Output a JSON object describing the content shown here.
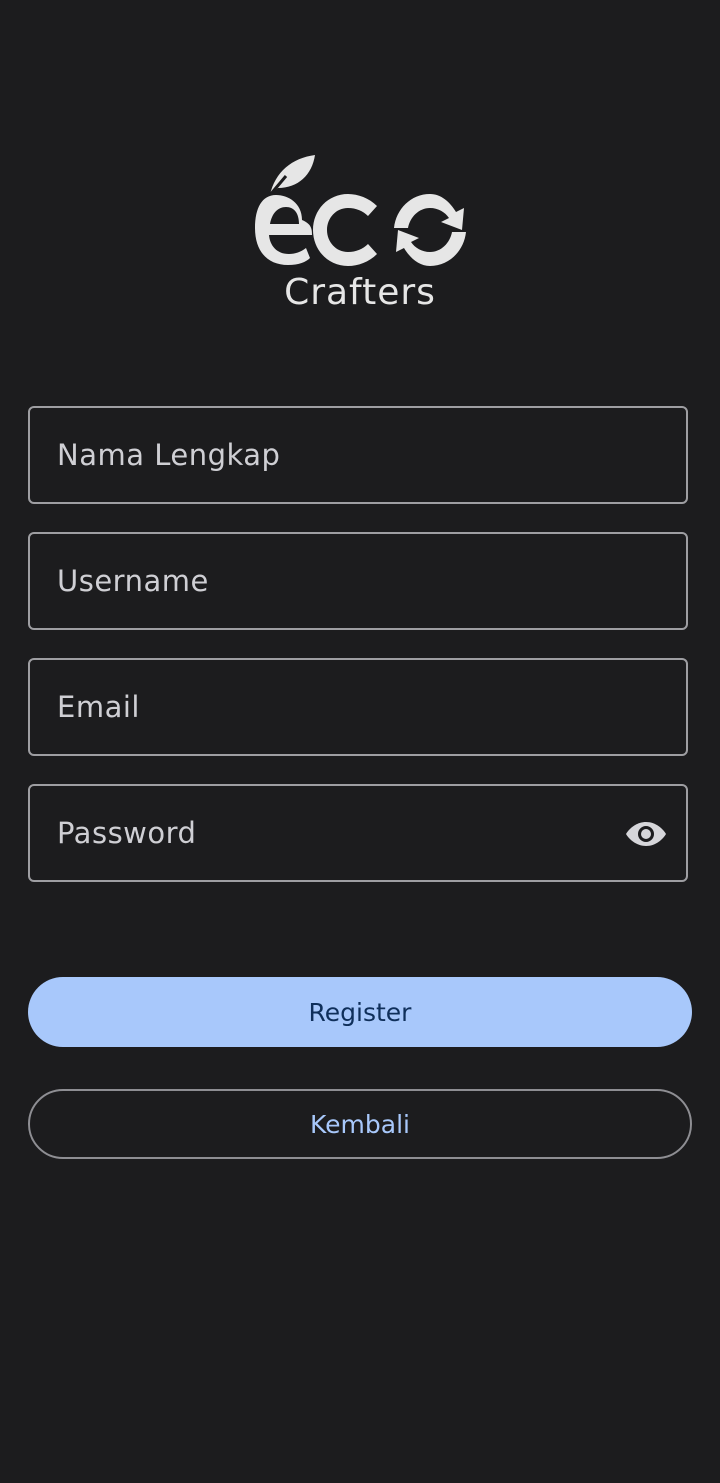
{
  "logo": {
    "wordmark": "eco",
    "subtitle": "Crafters"
  },
  "form": {
    "full_name_placeholder": "Nama Lengkap",
    "full_name_value": "",
    "username_placeholder": "Username",
    "username_value": "",
    "email_placeholder": "Email",
    "email_value": "",
    "password_placeholder": "Password",
    "password_value": "",
    "password_toggle_icon": "eye-icon"
  },
  "actions": {
    "register_label": "Register",
    "back_label": "Kembali"
  },
  "colors": {
    "background": "#1c1c1e",
    "primary_button": "#a8c8fb",
    "primary_button_text": "#0f2f5a",
    "outline_text": "#a8c8fb",
    "field_border": "#9e9ea2"
  }
}
